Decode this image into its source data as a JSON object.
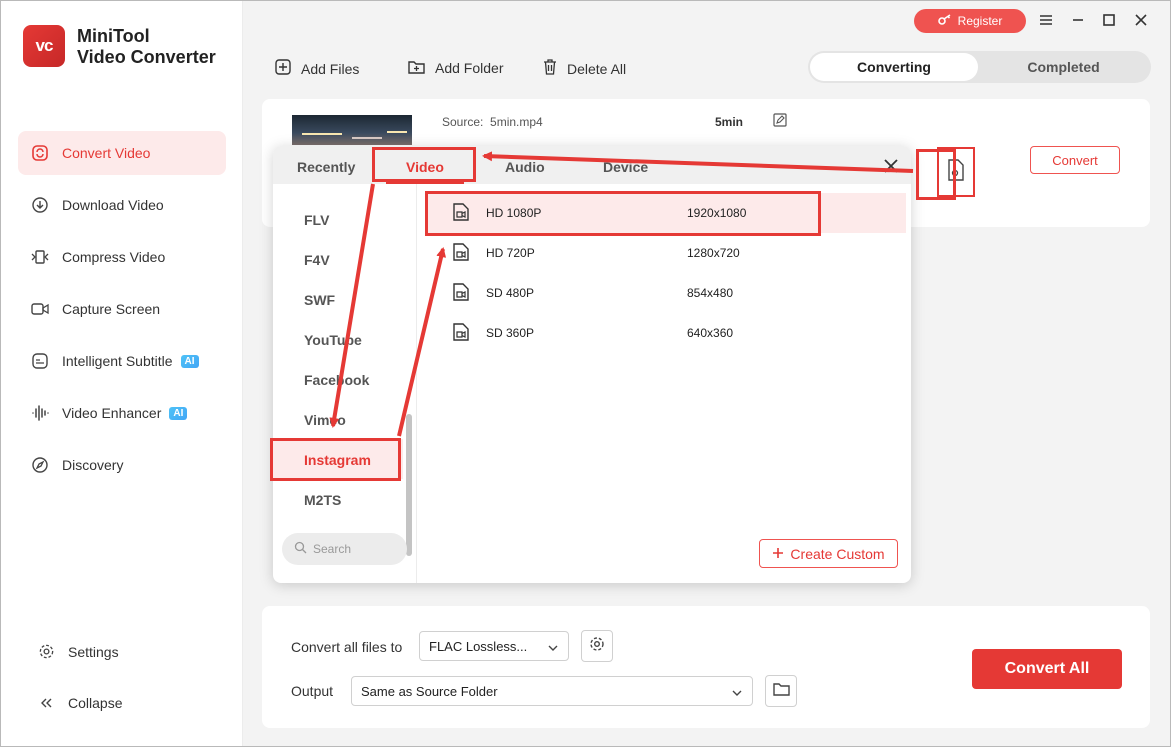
{
  "app": {
    "logo_text": "vc",
    "title_line1": "MiniTool",
    "title_line2": "Video Converter"
  },
  "sidebar": {
    "items": [
      {
        "label": "Convert Video",
        "icon": "convert-icon",
        "active": true
      },
      {
        "label": "Download Video",
        "icon": "download-icon"
      },
      {
        "label": "Compress Video",
        "icon": "compress-icon"
      },
      {
        "label": "Capture Screen",
        "icon": "camera-icon"
      },
      {
        "label": "Intelligent Subtitle",
        "icon": "subtitle-icon",
        "badge": "AI"
      },
      {
        "label": "Video Enhancer",
        "icon": "enhancer-icon",
        "badge": "AI"
      },
      {
        "label": "Discovery",
        "icon": "compass-icon"
      }
    ],
    "settings_label": "Settings",
    "collapse_label": "Collapse"
  },
  "topbar": {
    "register_label": "Register"
  },
  "toolbar": {
    "add_files": "Add Files",
    "add_folder": "Add Folder",
    "delete_all": "Delete All"
  },
  "tabs": {
    "converting": "Converting",
    "completed": "Completed"
  },
  "file": {
    "source_label": "Source:",
    "source_name": "5min.mp4",
    "duration": "5min",
    "convert_label": "Convert"
  },
  "popup": {
    "tabs": [
      "Recently",
      "Video",
      "Audio",
      "Device"
    ],
    "active_tab": "Video",
    "formats": [
      "FLV",
      "F4V",
      "SWF",
      "YouTube",
      "Facebook",
      "Vimeo",
      "Instagram",
      "M2TS"
    ],
    "selected_format": "Instagram",
    "presets": [
      {
        "name": "HD 1080P",
        "res": "1920x1080"
      },
      {
        "name": "HD 720P",
        "res": "1280x720"
      },
      {
        "name": "SD 480P",
        "res": "854x480"
      },
      {
        "name": "SD 360P",
        "res": "640x360"
      }
    ],
    "search_placeholder": "Search",
    "create_custom": "Create Custom"
  },
  "bottom": {
    "convert_all_to_label": "Convert all files to",
    "convert_all_to_value": "FLAC Lossless...",
    "output_label": "Output",
    "output_value": "Same as Source Folder",
    "convert_all_button": "Convert All"
  },
  "colors": {
    "accent": "#e53935",
    "accent_light": "#fdeaea"
  }
}
